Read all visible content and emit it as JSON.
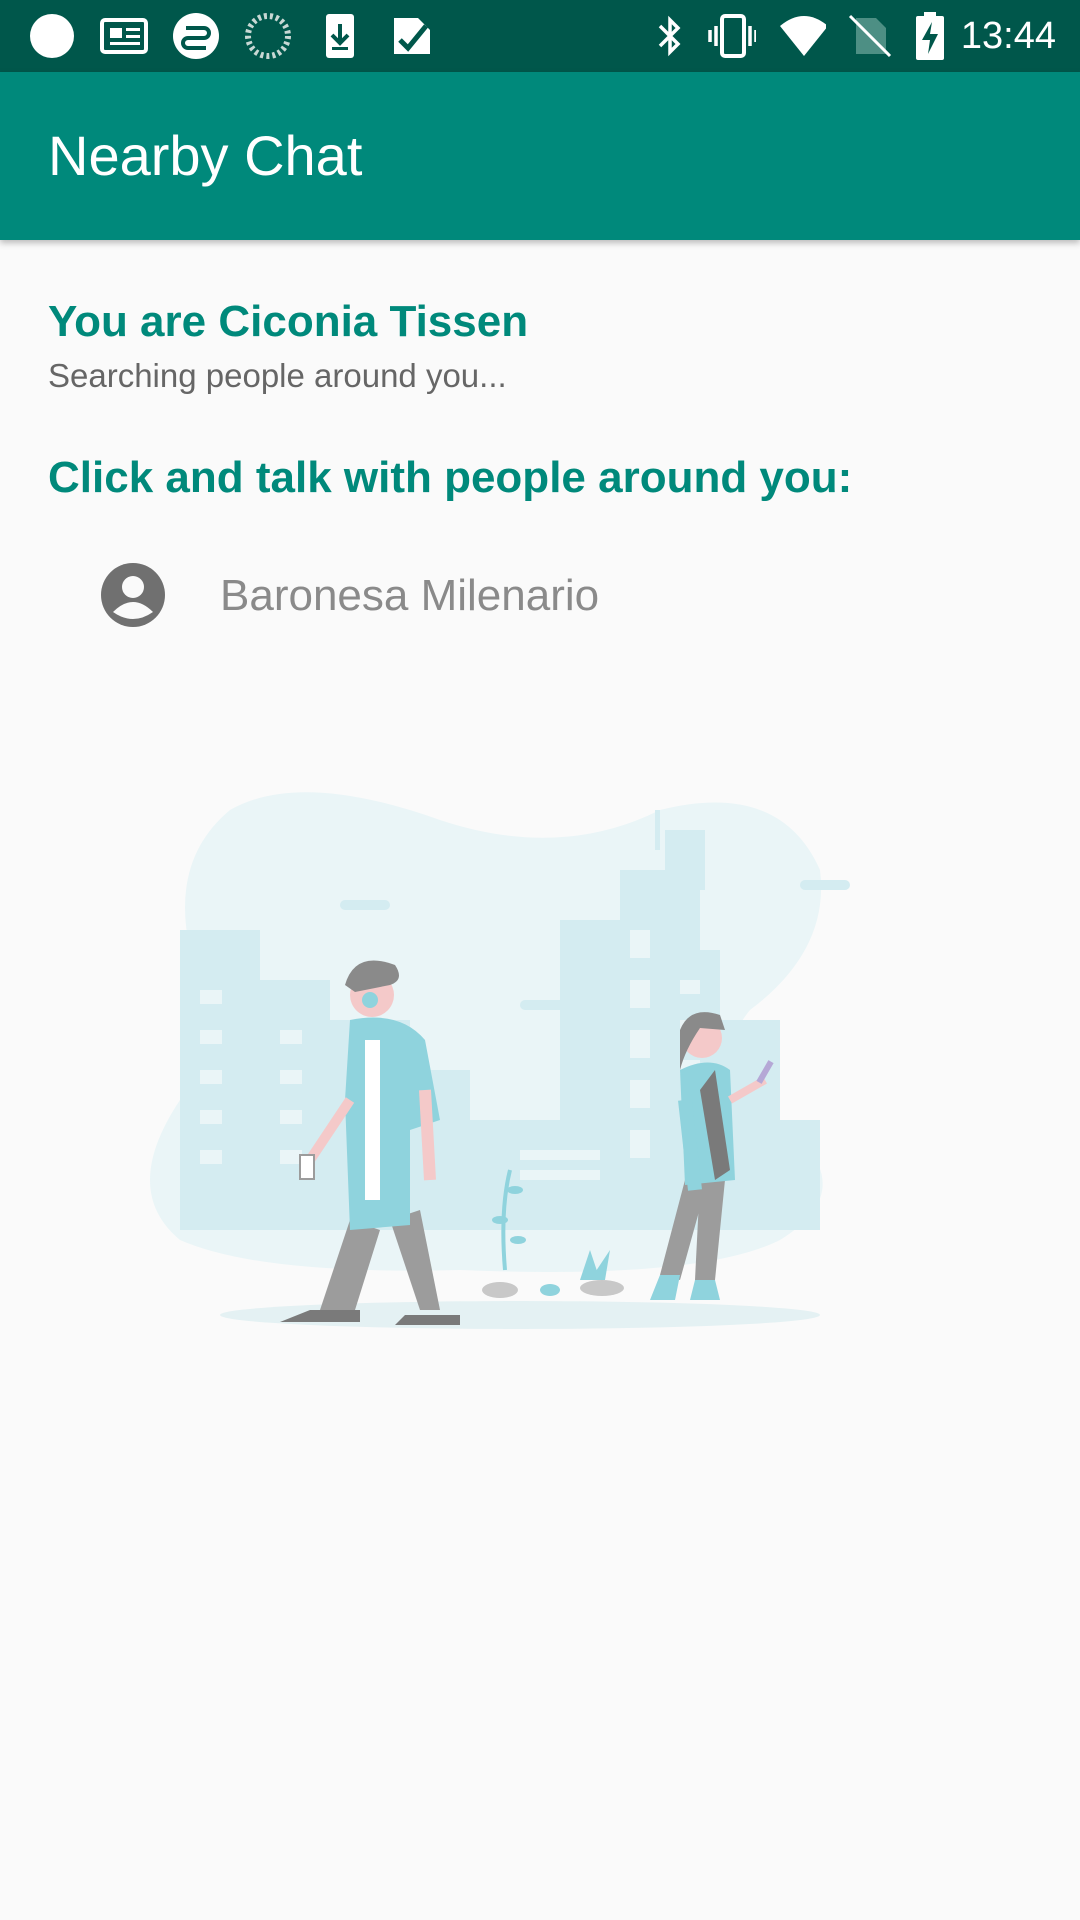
{
  "status_bar": {
    "time": "13:44",
    "left_icons": [
      "circle-notification-icon",
      "news-icon",
      "tasks-icon",
      "sync-icon",
      "download-icon",
      "checkmark-icon"
    ],
    "right_icons": [
      "bluetooth-icon",
      "vibrate-icon",
      "wifi-icon",
      "no-sim-icon",
      "battery-charging-icon"
    ]
  },
  "app_bar": {
    "title": "Nearby Chat"
  },
  "main": {
    "identity": "You are Ciconia Tissen",
    "status": "Searching people around you...",
    "prompt": "Click and talk with people around you:",
    "people": [
      {
        "name": "Baronesa Milenario",
        "icon": "account-circle-icon"
      }
    ]
  },
  "colors": {
    "status_bar": "#00574b",
    "app_bar": "#00897b",
    "accent_text": "#00897b",
    "background": "#fafafa"
  }
}
